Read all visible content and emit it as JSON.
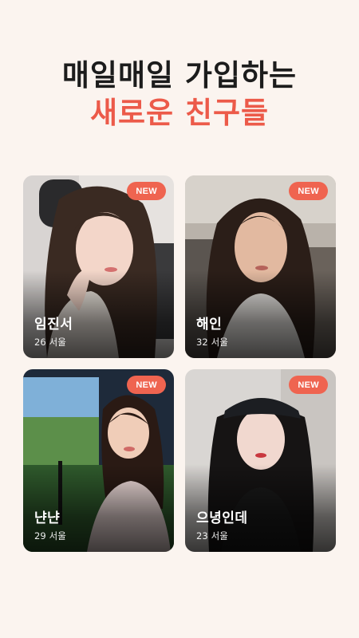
{
  "headline": {
    "line1": "매일매일 가입하는",
    "line2": "새로운 친구들"
  },
  "badge_label": "NEW",
  "colors": {
    "background": "#fbf4ef",
    "accent": "#ec5a49",
    "badge": "#ef6450"
  },
  "profiles": [
    {
      "name": "임진서",
      "age": "26",
      "city": "서울"
    },
    {
      "name": "해인",
      "age": "32",
      "city": "서울"
    },
    {
      "name": "냔냔",
      "age": "29",
      "city": "서울"
    },
    {
      "name": "으녕인데",
      "age": "23",
      "city": "서울"
    }
  ]
}
